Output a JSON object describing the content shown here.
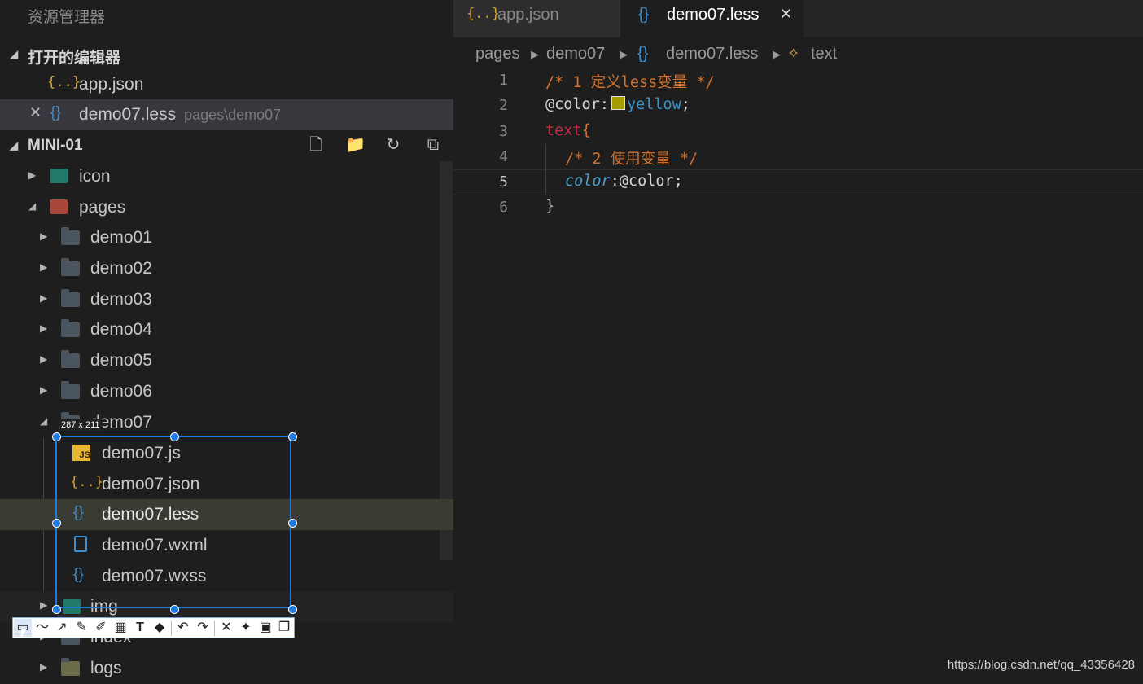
{
  "explorer": {
    "title": "资源管理器",
    "open_editors": {
      "header": "打开的编辑器",
      "items": [
        {
          "icon": "json-icon",
          "label": "app.json",
          "hint": ""
        },
        {
          "icon": "less-icon",
          "label": "demo07.less",
          "hint": "pages\\demo07",
          "close": "✕"
        }
      ]
    },
    "project": {
      "header": "MINI-01",
      "tools": [
        "new-file-icon",
        "new-folder-icon",
        "refresh-icon",
        "collapse-all-icon"
      ],
      "tree": [
        {
          "label": "icon"
        },
        {
          "label": "pages"
        },
        {
          "label": "demo01"
        },
        {
          "label": "demo02"
        },
        {
          "label": "demo03"
        },
        {
          "label": "demo04"
        },
        {
          "label": "demo05"
        },
        {
          "label": "demo06"
        },
        {
          "label": "demo07"
        },
        {
          "label": "demo07.js"
        },
        {
          "label": "demo07.json"
        },
        {
          "label": "demo07.less"
        },
        {
          "label": "demo07.wxml"
        },
        {
          "label": "demo07.wxss"
        },
        {
          "label": "img"
        },
        {
          "label": "index"
        },
        {
          "label": "logs"
        }
      ]
    }
  },
  "tabs": [
    {
      "label": "app.json",
      "icon": "{..}"
    },
    {
      "label": "demo07.less",
      "icon": "{}",
      "close": "✕"
    }
  ],
  "breadcrumb": [
    "pages",
    "demo07",
    "demo07.less",
    "text"
  ],
  "editor": {
    "line_numbers": [
      "1",
      "2",
      "3",
      "4",
      "5",
      "6"
    ],
    "lines": {
      "l1": "/* 1 定义less变量 */",
      "l2_var": "@color:",
      "l2_val": "yellow",
      "l2_end": ";",
      "l3_sel": "text",
      "l3_brace": "{",
      "l4": "/* 2 使用变量 */",
      "l5_prop": "color",
      "l5_rest": ":@color;",
      "l6": "}"
    },
    "swatch_color": "#a59d00"
  },
  "capture": {
    "size_label": "287 x 211",
    "toolbar": [
      "rect-icon",
      "pen-line-icon",
      "arrow-icon",
      "pencil-icon",
      "marker-icon",
      "mosaic-icon",
      "text-icon",
      "eraser-icon",
      "undo-icon",
      "redo-icon",
      "cancel-icon",
      "pin-icon",
      "save-icon",
      "copy-icon"
    ]
  },
  "watermark": "https://blog.csdn.net/qq_43356428"
}
